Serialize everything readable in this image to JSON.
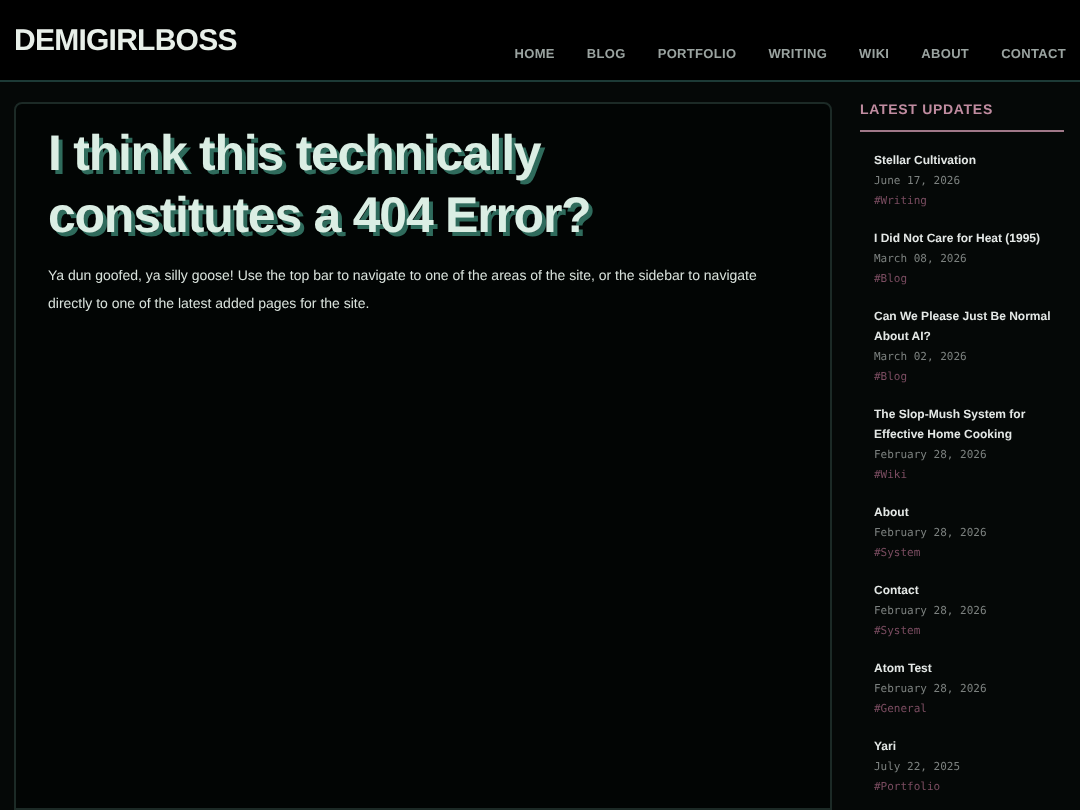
{
  "site": {
    "title": "DEMIGIRLBOSS"
  },
  "nav": [
    {
      "label": "HOME"
    },
    {
      "label": "BLOG"
    },
    {
      "label": "PORTFOLIO"
    },
    {
      "label": "WRITING"
    },
    {
      "label": "WIKI"
    },
    {
      "label": "ABOUT"
    },
    {
      "label": "CONTACT"
    }
  ],
  "main": {
    "heading": "I think this technically constitutes a 404 Error?",
    "body": "Ya dun goofed, ya silly goose! Use the top bar to navigate to one of the areas of the site, or the sidebar to navigate directly to one of the latest added pages for the site."
  },
  "sidebar": {
    "heading": "LATEST UPDATES",
    "items": [
      {
        "title": "Stellar Cultivation",
        "date": "June 17, 2026",
        "tag": "#Writing"
      },
      {
        "title": "I Did Not Care for Heat (1995)",
        "date": "March 08, 2026",
        "tag": "#Blog"
      },
      {
        "title": "Can We Please Just Be Normal About AI?",
        "date": "March 02, 2026",
        "tag": "#Blog"
      },
      {
        "title": "The Slop-Mush System for Effective Home Cooking",
        "date": "February 28, 2026",
        "tag": "#Wiki"
      },
      {
        "title": "About",
        "date": "February 28, 2026",
        "tag": "#System"
      },
      {
        "title": "Contact",
        "date": "February 28, 2026",
        "tag": "#System"
      },
      {
        "title": "Atom Test",
        "date": "February 28, 2026",
        "tag": "#General"
      },
      {
        "title": "Yari",
        "date": "July 22, 2025",
        "tag": "#Portfolio"
      }
    ]
  }
}
